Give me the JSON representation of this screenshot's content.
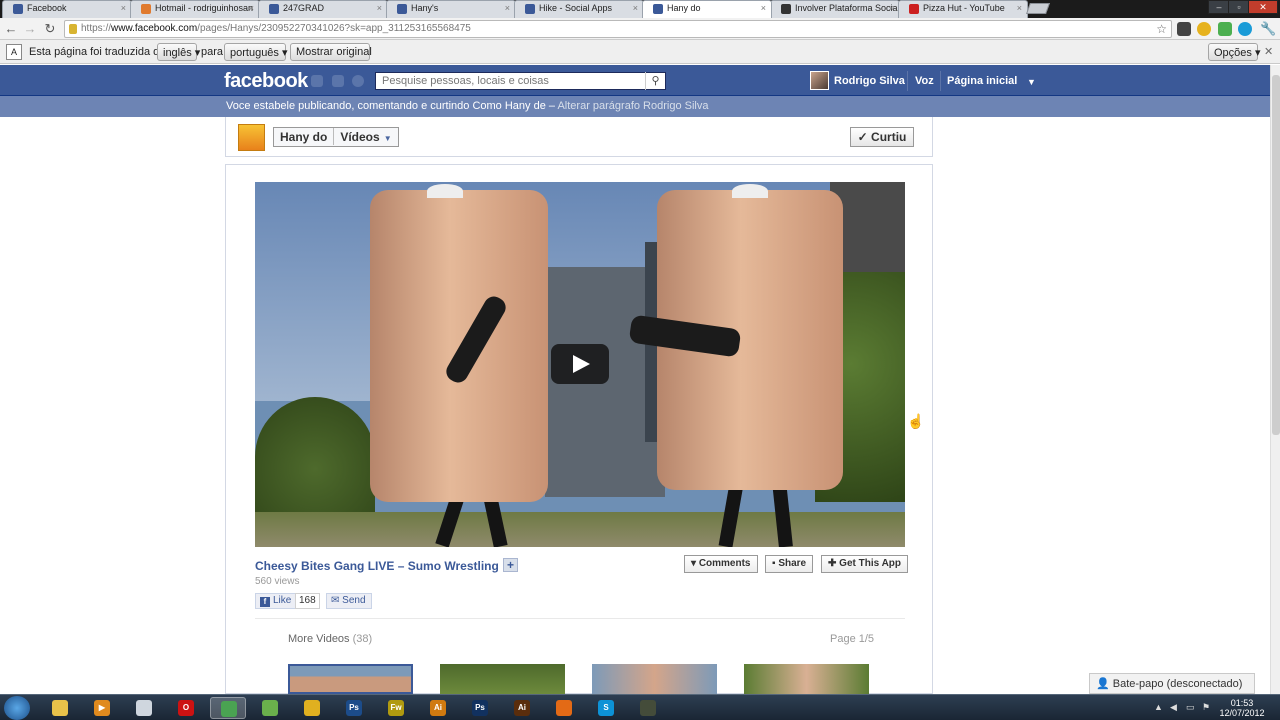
{
  "browser": {
    "tabs": [
      {
        "label": "Facebook",
        "color": "#3b5998"
      },
      {
        "label": "Hotmail - rodriguinhosan",
        "color": "#e07a2e"
      },
      {
        "label": "247GRAD",
        "color": "#3b5998"
      },
      {
        "label": "Hany's",
        "color": "#3b5998"
      },
      {
        "label": "Hike - Social Apps",
        "color": "#3b5998"
      },
      {
        "label": "Hany do",
        "color": "#3b5998"
      },
      {
        "label": "Involver Plataforma Social",
        "color": "#333333"
      },
      {
        "label": "Pizza Hut - YouTube",
        "color": "#cc2020"
      }
    ],
    "url_scheme": "https://",
    "url_host": "www.facebook.com",
    "url_path": "/pages/Hanys/230952270341026?sk=app_311253165568475"
  },
  "translate_bar": {
    "prefix": "Esta página foi traduzida de",
    "from_lang": "inglês",
    "middle": "para",
    "to_lang": "português",
    "show_original": "Mostrar original",
    "options": "Opções"
  },
  "facebook": {
    "logo": "facebook",
    "search_placeholder": "Pesquise pessoas, locais e coisas",
    "user_name": "Rodrigo Silva",
    "nav_voz": "Voz",
    "nav_home": "Página inicial",
    "notice_text": "Voce estabele publicando, comentando e curtindo Como Hany de –",
    "notice_link": "Alterar parágrafo Rodrigo Silva",
    "brand_color": "#3b5998"
  },
  "page": {
    "name": "Hany do",
    "section": "Vídeos",
    "like_button": "Curtiu"
  },
  "video": {
    "title": "Cheesy Bites Gang LIVE – Sumo Wrestling",
    "views": "560 views",
    "like_label": "Like",
    "like_count": "168",
    "send_label": "Send",
    "comments_label": "Comments",
    "share_label": "Share",
    "get_app_label": "Get This App",
    "more_videos_label": "More Videos",
    "more_videos_count": "(38)",
    "pager": "Page 1/5"
  },
  "chat": {
    "label": "Bate-papo (desconectado)"
  },
  "taskbar": {
    "time": "01:53",
    "date": "12/07/2012",
    "apps": [
      {
        "name": "explorer-icon",
        "glyph": "",
        "color": "#e8c24a"
      },
      {
        "name": "media-player-icon",
        "glyph": "▶",
        "color": "#e08a1e"
      },
      {
        "name": "usb-icon",
        "glyph": "",
        "color": "#cfd6de"
      },
      {
        "name": "opera-icon",
        "glyph": "O",
        "color": "#cc1212"
      },
      {
        "name": "chrome-icon",
        "glyph": "",
        "color": "#4aa352"
      },
      {
        "name": "messenger-icon",
        "glyph": "",
        "color": "#6ab04c"
      },
      {
        "name": "pen-tool-icon",
        "glyph": "",
        "color": "#e0b020"
      },
      {
        "name": "photoshop-icon",
        "glyph": "Ps",
        "color": "#1c4c8a"
      },
      {
        "name": "fireworks-icon",
        "glyph": "Fw",
        "color": "#b09a10"
      },
      {
        "name": "illustrator-icon",
        "glyph": "Ai",
        "color": "#d07a10"
      },
      {
        "name": "photoshop2-icon",
        "glyph": "Ps",
        "color": "#11315f"
      },
      {
        "name": "illustrator2-icon",
        "glyph": "Ai",
        "color": "#5a2d0c"
      },
      {
        "name": "firefox-icon",
        "glyph": "",
        "color": "#e36a16"
      },
      {
        "name": "skype-icon",
        "glyph": "S",
        "color": "#0d92d6"
      },
      {
        "name": "terminal-icon",
        "glyph": "",
        "color": "#444c3a"
      }
    ]
  }
}
